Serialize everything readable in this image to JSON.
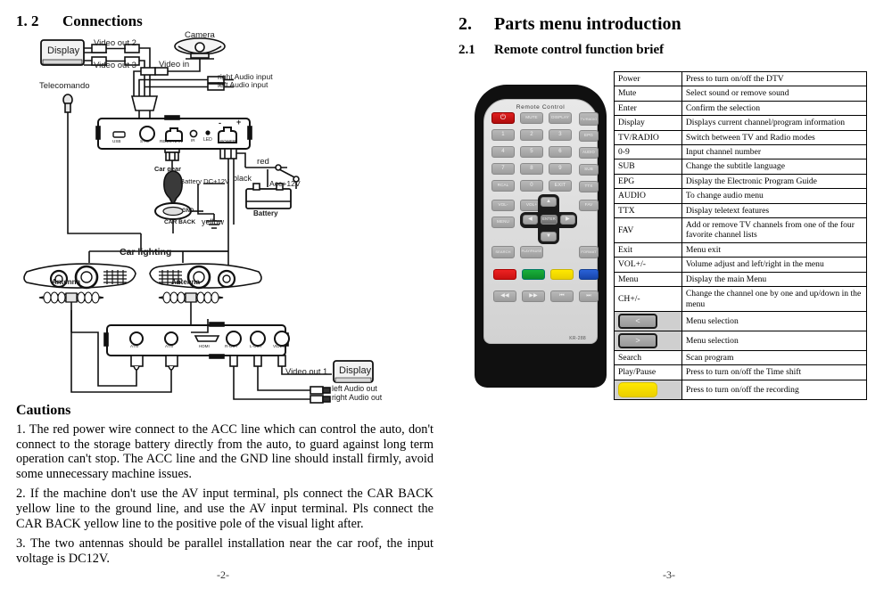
{
  "left_page": {
    "section": {
      "number": "1. 2",
      "title": "Connections"
    },
    "page_number": "-2-",
    "diagram_labels": {
      "display_top": "Display",
      "video_out_2": "Video out 2",
      "video_out_3": "Video out 3",
      "camera": "Camera",
      "video_in": "Video in",
      "right_audio_input": "right Audio input",
      "left_audio_input": "left Audio input",
      "telecomando": "Telecomando",
      "port_usb": "USB",
      "port_sav": "S-AV",
      "port_remote_in": "REMOTE IN",
      "port_ir": "IR",
      "port_led": "LED",
      "port_power": "POWER",
      "polarity_minus": "-",
      "polarity_plus": "+",
      "car_gear": "Car gear",
      "battery_dc12v": "Battery DC+12V",
      "gnd": "GND",
      "car_back": "CAR BACK",
      "yellow": "yellow",
      "red": "red",
      "black": "black",
      "acc12v": "Acc+12V",
      "battery": "Battery",
      "car_lighting": "Car lighting",
      "antenna_left": "Antenna",
      "antenna_right": "Antenna",
      "port_atn_1": "ATN",
      "port_atn_2": "ATN",
      "port_hdmi": "HDMI",
      "port_r_out": "R-OUT",
      "port_l_out": "L-OUT",
      "port_video": "VIDEO",
      "video_out_1": "Video out 1",
      "display_bottom": "Display",
      "left_audio_out": "left Audio out",
      "right_audio_out": "right Audio out"
    },
    "cautions": {
      "title": "Cautions",
      "items": [
        "1.  The red power wire connect to the ACC line which can control the auto, don't connect to the storage battery directly from the auto, to guard against long term operation can't stop. The ACC line and the GND line should install firmly, avoid some unnecessary machine issues.",
        "2.  If the machine don't use the AV input terminal, pls connect the CAR BACK yellow line to the ground line, and use the AV input terminal. Pls connect the CAR BACK yellow line to the positive pole of the visual light after.",
        "3.   The two antennas should be parallel installation near the car roof, the input voltage is DC12V."
      ]
    }
  },
  "right_page": {
    "section": {
      "number": "2.",
      "title": "Parts menu introduction"
    },
    "subsection": {
      "number": "2.1",
      "title": "Remote control function brief"
    },
    "page_number": "-3-",
    "remote": {
      "title": "Remote Control",
      "model": "KR-288",
      "keys": {
        "power": "⏻",
        "mute": "MUTE",
        "display": "DISPLAY",
        "tv_radio": "TV/RADIO",
        "n1": "1",
        "n2": "2",
        "n3": "3",
        "n4": "4",
        "n5": "5",
        "n6": "6",
        "n7": "7",
        "n8": "8",
        "n9": "9",
        "n0": "0",
        "recall": "RCAL",
        "exit": "EXIT",
        "epg": "EPG",
        "audio": "AUDIO",
        "sub": "SUB",
        "ttx": "TTX",
        "fav": "FAV",
        "vol_minus": "VOL-",
        "vol_plus": "VOL+",
        "menu": "MENU",
        "search": "SEARCH",
        "play_pause": "PLAY/PAUSE",
        "format": "FORMAT",
        "enter": "ENTER",
        "up": "▲",
        "down": "▼",
        "left": "◀",
        "right": "▶",
        "ch_plus": "CH+",
        "ch_minus": "CH-",
        "rew": "◀◀",
        "ff": "▶▶",
        "prev": "⏮",
        "next": "⏭",
        "color_red": "red",
        "color_green": "green",
        "color_yellow": "yellow",
        "color_blue": "blue"
      }
    },
    "function_table": {
      "rows": [
        {
          "key": "Power",
          "desc": "Press to turn on/off the DTV",
          "type": "text"
        },
        {
          "key": "Mute",
          "desc": "Select sound or remove sound",
          "type": "text"
        },
        {
          "key": "Enter",
          "desc": "Confirm the selection",
          "type": "text"
        },
        {
          "key": "Display",
          "desc": "Displays current channel/program information",
          "type": "text"
        },
        {
          "key": "TV/RADIO",
          "desc": "Switch between TV and Radio modes",
          "type": "text"
        },
        {
          "key": "0-9",
          "desc": "Input channel number",
          "type": "text"
        },
        {
          "key": "SUB",
          "desc": "Change the subtitle language",
          "type": "text"
        },
        {
          "key": "EPG",
          "desc": "Display the Electronic Program Guide",
          "type": "text"
        },
        {
          "key": "AUDIO",
          "desc": "To change audio menu",
          "type": "text"
        },
        {
          "key": "TTX",
          "desc": "Display teletext features",
          "type": "text"
        },
        {
          "key": "FAV",
          "desc": "Add or remove TV channels from one of the four favorite channel lists",
          "type": "text"
        },
        {
          "key": "Exit",
          "desc": "Menu exit",
          "type": "text"
        },
        {
          "key": "VOL+/-",
          "desc": "Volume adjust and left/right in the menu",
          "type": "text"
        },
        {
          "key": "Menu",
          "desc": "Display the main Menu",
          "type": "text"
        },
        {
          "key": "CH+/-",
          "desc": "Change the channel one by one and up/down in the menu",
          "type": "text"
        },
        {
          "key": "<",
          "desc": "Menu selection",
          "type": "key"
        },
        {
          "key": ">",
          "desc": "Menu selection",
          "type": "key"
        },
        {
          "key": "Search",
          "desc": "Scan program",
          "type": "text"
        },
        {
          "key": "Play/Pause",
          "desc": "Press to turn on/off the Time shift",
          "type": "text"
        },
        {
          "key": "",
          "desc": "Press to turn on/off the recording",
          "type": "yellow"
        }
      ]
    }
  }
}
